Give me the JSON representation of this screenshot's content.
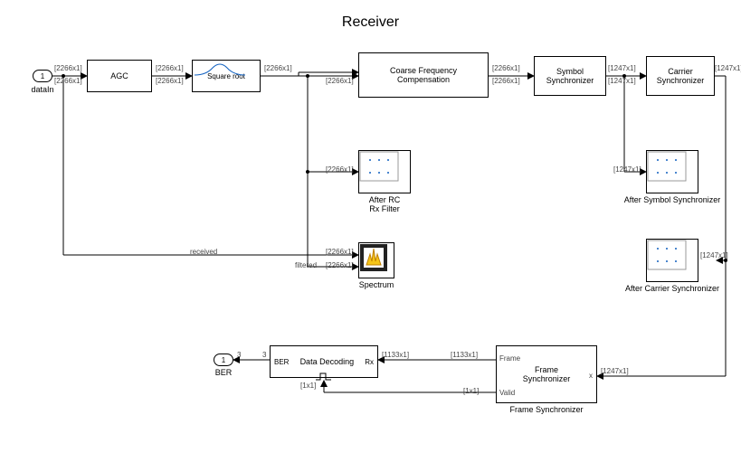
{
  "title": "Receiver",
  "ports": {
    "datain": {
      "num": "1",
      "label": "dataIn"
    },
    "ber": {
      "num": "1",
      "label": "BER"
    }
  },
  "blocks": {
    "agc": "AGC",
    "sqrt": "Square root",
    "cfc": "Coarse Frequency\nCompensation",
    "symsync": "Symbol\nSynchronizer",
    "carsync": "Carrier\nSynchronizer",
    "afterrc": "After RC\nRx Filter",
    "aftersym": "After Symbol Synchronizer",
    "aftercar": "After Carrier Synchronizer",
    "spectrum": "Spectrum",
    "framesync": "Frame\nSynchronizer",
    "framesync_lbl": "Frame Synchronizer",
    "decode_left": "BER",
    "decode_mid": "Data Decoding",
    "decode_rx": "Rx",
    "frame_out": "Frame",
    "valid_out": "Valid",
    "frame_in": "x"
  },
  "signals": {
    "s2266": "[2266x1]",
    "s1247": "[1247x1]",
    "s1133": "[1133x1]",
    "s1x1": "[1x1]",
    "received": "received",
    "filtered": "filtered",
    "n3": "3"
  }
}
